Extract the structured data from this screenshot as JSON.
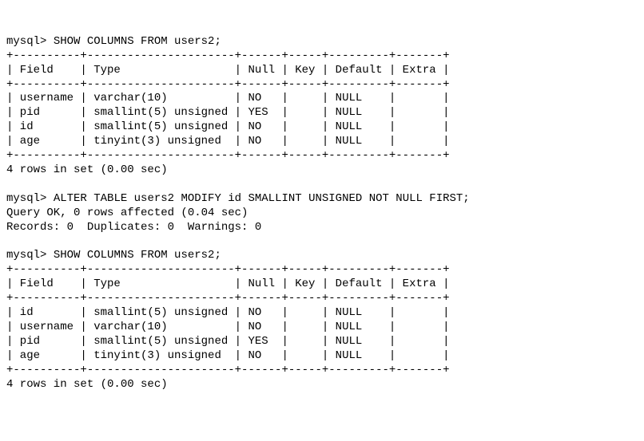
{
  "prompt": "mysql>",
  "commands": {
    "show1": "SHOW COLUMNS FROM users2;",
    "alter": "ALTER TABLE users2 MODIFY id SMALLINT UNSIGNED NOT NULL FIRST;",
    "show2": "SHOW COLUMNS FROM users2;"
  },
  "chart_data": [
    {
      "type": "table",
      "headers": [
        "Field",
        "Type",
        "Null",
        "Key",
        "Default",
        "Extra"
      ],
      "rows": [
        [
          "username",
          "varchar(10)",
          "NO",
          "",
          "NULL",
          ""
        ],
        [
          "pid",
          "smallint(5) unsigned",
          "YES",
          "",
          "NULL",
          ""
        ],
        [
          "id",
          "smallint(5) unsigned",
          "NO",
          "",
          "NULL",
          ""
        ],
        [
          "age",
          "tinyint(3) unsigned",
          "NO",
          "",
          "NULL",
          ""
        ]
      ],
      "summary": "4 rows in set (0.00 sec)"
    },
    {
      "type": "table",
      "headers": [
        "Field",
        "Type",
        "Null",
        "Key",
        "Default",
        "Extra"
      ],
      "rows": [
        [
          "id",
          "smallint(5) unsigned",
          "NO",
          "",
          "NULL",
          ""
        ],
        [
          "username",
          "varchar(10)",
          "NO",
          "",
          "NULL",
          ""
        ],
        [
          "pid",
          "smallint(5) unsigned",
          "YES",
          "",
          "NULL",
          ""
        ],
        [
          "age",
          "tinyint(3) unsigned",
          "NO",
          "",
          "NULL",
          ""
        ]
      ],
      "summary": "4 rows in set (0.00 sec)"
    }
  ],
  "alter_result": {
    "line1": "Query OK, 0 rows affected (0.04 sec)",
    "line2": "Records: 0  Duplicates: 0  Warnings: 0"
  },
  "widths": {
    "Field": 10,
    "Type": 22,
    "Null": 6,
    "Key": 5,
    "Default": 9,
    "Extra": 7
  }
}
